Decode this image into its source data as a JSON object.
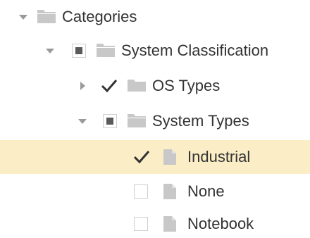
{
  "tree": {
    "root": {
      "label": "Categories",
      "state": "expanded"
    },
    "system_classification": {
      "label": "System Classification",
      "state": "expanded",
      "check": "partial"
    },
    "os_types": {
      "label": "OS Types",
      "state": "collapsed",
      "check": "checked"
    },
    "system_types": {
      "label": "System Types",
      "state": "expanded",
      "check": "partial"
    },
    "industrial": {
      "label": "Industrial",
      "check": "checked",
      "selected": true
    },
    "none": {
      "label": "None",
      "check": "unchecked"
    },
    "notebook": {
      "label": "Notebook",
      "check": "unchecked"
    }
  },
  "colors": {
    "selected_row": "#fbeec7",
    "folder": "#c8c8c8",
    "file": "#c8c8c8",
    "arrow": "#9a9a9a",
    "text": "#333333"
  }
}
